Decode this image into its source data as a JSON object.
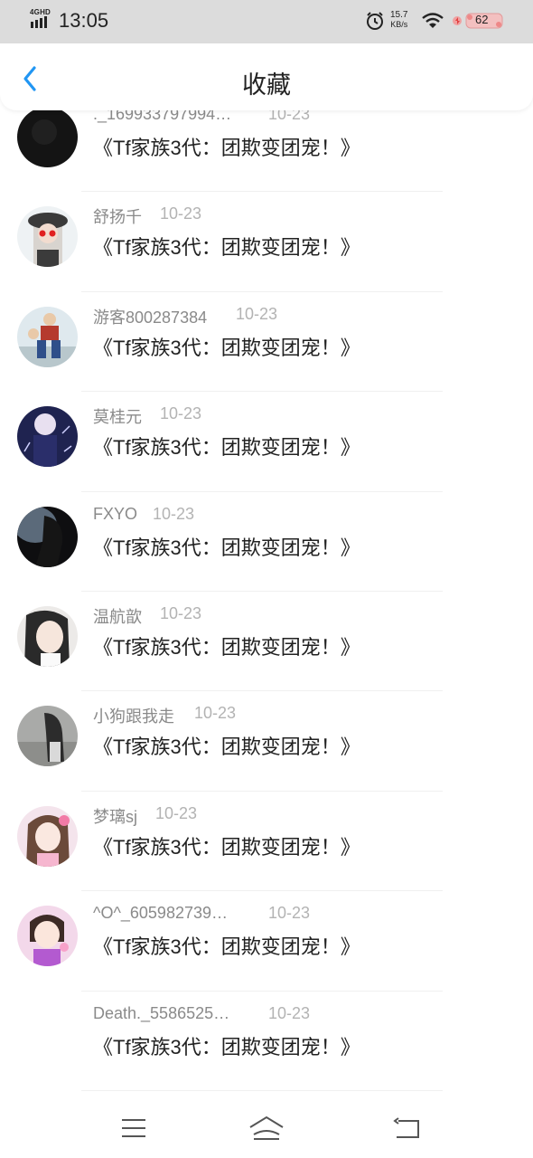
{
  "status_bar": {
    "network": "4GHD",
    "time": "13:05",
    "speed_value": "15.7",
    "speed_unit": "KB/s",
    "battery": "62",
    "icons": [
      "signal-icon",
      "alarm-icon",
      "wifi-icon",
      "battery-icon"
    ]
  },
  "header": {
    "title": "收藏",
    "back_icon": "chevron-left-icon",
    "accent_color": "#2196f3"
  },
  "items": [
    {
      "user": "._169933797994…",
      "date": "10-23",
      "text": "《Tf家族3代：团欺变团宠！》"
    },
    {
      "user": "舒扬千",
      "date": "10-23",
      "text": "《Tf家族3代：团欺变团宠！》"
    },
    {
      "user": "游客800287384",
      "date": "10-23",
      "text": "《Tf家族3代：团欺变团宠！》"
    },
    {
      "user": "莫桂元",
      "date": "10-23",
      "text": "《Tf家族3代：团欺变团宠！》"
    },
    {
      "user": "FXYO",
      "date": "10-23",
      "text": "《Tf家族3代：团欺变团宠！》"
    },
    {
      "user": "温航歆",
      "date": "10-23",
      "text": "《Tf家族3代：团欺变团宠！》"
    },
    {
      "user": "小狗跟我走",
      "date": "10-23",
      "text": "《Tf家族3代：团欺变团宠！》"
    },
    {
      "user": "梦璃sj",
      "date": "10-23",
      "text": "《Tf家族3代：团欺变团宠！》"
    },
    {
      "user": "^O^_605982739…",
      "date": "10-23",
      "text": "《Tf家族3代：团欺变团宠！》"
    },
    {
      "user": "Death._5586525…",
      "date": "10-23",
      "text": "《Tf家族3代：团欺变团宠！》"
    }
  ],
  "nav": {
    "icons": [
      "menu-icon",
      "home-icon",
      "back-icon"
    ]
  }
}
